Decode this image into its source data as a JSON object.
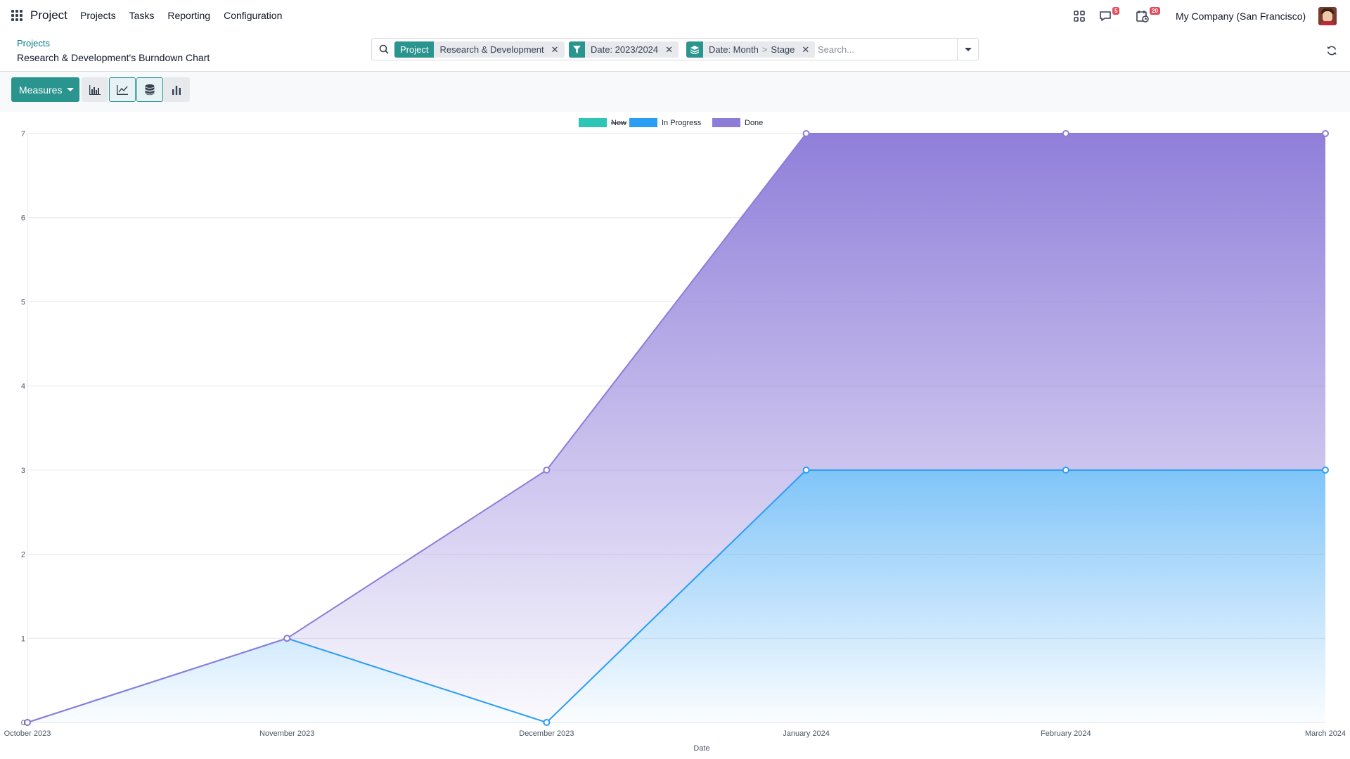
{
  "navbar": {
    "app_name": "Project",
    "menu": [
      "Projects",
      "Tasks",
      "Reporting",
      "Configuration"
    ],
    "messages_badge": "5",
    "activities_badge": "20",
    "company": "My Company (San Francisco)"
  },
  "breadcrumb": {
    "parent": "Projects",
    "current": "Research & Development's Burndown Chart"
  },
  "search": {
    "facets": [
      {
        "type": "field",
        "label": "Project",
        "values": [
          "Research & Development"
        ]
      },
      {
        "type": "filter",
        "icon": "filter-icon",
        "values": [
          "Date: 2023/2024"
        ]
      },
      {
        "type": "groupby",
        "icon": "layers-icon",
        "values": [
          "Date: Month",
          "Stage"
        ]
      }
    ],
    "placeholder": "Search..."
  },
  "toolbar": {
    "measures_label": "Measures",
    "buttons": [
      {
        "name": "bar-chart",
        "icon": "bar-chart-icon",
        "active": false
      },
      {
        "name": "line-chart",
        "icon": "line-chart-icon",
        "active": true
      },
      {
        "name": "stacked",
        "icon": "database-icon",
        "active": true
      },
      {
        "name": "pie-chart",
        "icon": "column-chart-icon",
        "active": false
      }
    ]
  },
  "chart_data": {
    "type": "area",
    "stacked": true,
    "categories": [
      "October 2023",
      "November 2023",
      "December 2023",
      "January 2024",
      "February 2024",
      "March 2024"
    ],
    "series": [
      {
        "name": "New",
        "values": [
          0,
          0,
          0,
          0,
          0,
          0
        ],
        "color": "#2ec4b6",
        "hidden": true
      },
      {
        "name": "In Progress",
        "values": [
          0,
          1,
          0,
          3,
          3,
          3
        ],
        "color": "#2a9df4"
      },
      {
        "name": "Done",
        "values": [
          0,
          0,
          3,
          4,
          4,
          4
        ],
        "color": "#8e7cd9"
      }
    ],
    "xlabel": "Date",
    "ylabel": "",
    "ylim": [
      0,
      7
    ],
    "yticks": [
      "0",
      "1",
      "2",
      "3",
      "4",
      "5",
      "6",
      "7"
    ],
    "grid": true,
    "legend": "top-center"
  }
}
